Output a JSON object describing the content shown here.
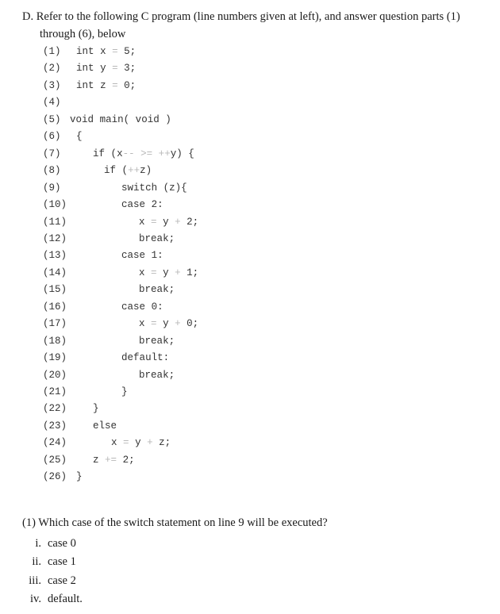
{
  "intro": {
    "line1": "D. Refer to the following C program (line numbers given at left), and answer question parts (1)",
    "line2": "through (6), below"
  },
  "code_lines": [
    {
      "num": "(1)",
      "code": "int x = 5;"
    },
    {
      "num": "(2)",
      "code": "int y = 3;"
    },
    {
      "num": "(3)",
      "code": "int z = 0;"
    },
    {
      "num": "(4)",
      "code": ""
    },
    {
      "num": "(5)",
      "code": "void main( void )"
    },
    {
      "num": "(6)",
      "code": "{"
    },
    {
      "num": "(7)",
      "code": "if (x-- >= ++y) {"
    },
    {
      "num": "(8)",
      "code": "if (++z)"
    },
    {
      "num": "(9)",
      "code": "switch (z){"
    },
    {
      "num": "(10)",
      "code": "case 2:"
    },
    {
      "num": "(11)",
      "code": "x = y + 2;"
    },
    {
      "num": "(12)",
      "code": "break;"
    },
    {
      "num": "(13)",
      "code": "case 1:"
    },
    {
      "num": "(14)",
      "code": "x = y + 1;"
    },
    {
      "num": "(15)",
      "code": "break;"
    },
    {
      "num": "(16)",
      "code": "case 0:"
    },
    {
      "num": "(17)",
      "code": "x = y + 0;"
    },
    {
      "num": "(18)",
      "code": "break;"
    },
    {
      "num": "(19)",
      "code": "default:"
    },
    {
      "num": "(20)",
      "code": "break;"
    },
    {
      "num": "(21)",
      "code": "}"
    },
    {
      "num": "(22)",
      "code": "}"
    },
    {
      "num": "(23)",
      "code": "else"
    },
    {
      "num": "(24)",
      "code": "x = y + z;"
    },
    {
      "num": "(25)",
      "code": "z += 2;"
    },
    {
      "num": "(26)",
      "code": "}"
    }
  ],
  "question": {
    "text": "(1) Which case of the switch statement on line 9 will be executed?",
    "options": [
      {
        "num": "i.",
        "label": "case 0"
      },
      {
        "num": "ii.",
        "label": "case 1"
      },
      {
        "num": "iii.",
        "label": "case 2"
      },
      {
        "num": "iv.",
        "label": "default."
      }
    ]
  }
}
